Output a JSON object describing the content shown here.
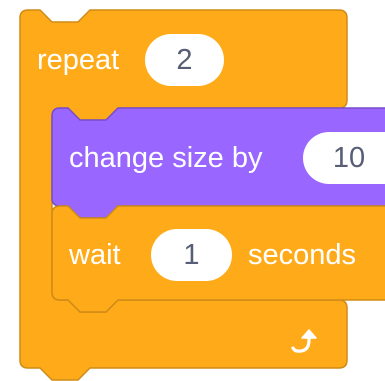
{
  "colors": {
    "control": "#ffab19",
    "control_border": "#cf8b17",
    "looks": "#9966ff",
    "looks_border": "#774dcb",
    "input_text": "#575e75",
    "input_bg": "#ffffff"
  },
  "repeat_block": {
    "label": "repeat",
    "count": "2",
    "loop_icon": "loop-arrow-icon"
  },
  "change_size_block": {
    "label": "change size by",
    "value": "10"
  },
  "wait_block": {
    "label": "wait",
    "value": "1",
    "unit": "seconds"
  }
}
